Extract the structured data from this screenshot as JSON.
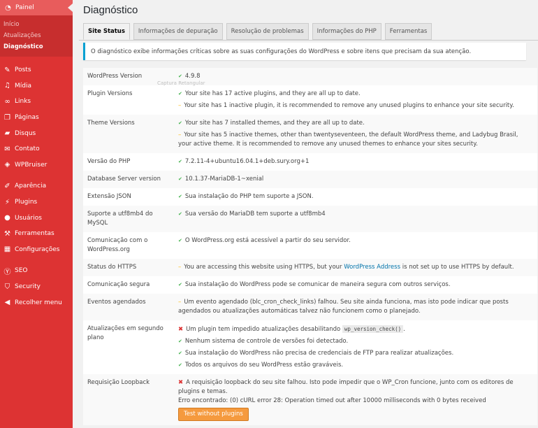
{
  "sidebar": {
    "top_item": "Painel",
    "submenu": [
      "Início",
      "Atualizações",
      "Diagnóstico"
    ],
    "items": [
      {
        "label": "Posts",
        "icon": "pushpin-icon"
      },
      {
        "label": "Mídia",
        "icon": "media-icon"
      },
      {
        "label": "Links",
        "icon": "links-icon"
      },
      {
        "label": "Páginas",
        "icon": "pages-icon"
      },
      {
        "label": "Disqus",
        "icon": "comment-icon"
      },
      {
        "label": "Contato",
        "icon": "mail-icon"
      },
      {
        "label": "WPBruiser",
        "icon": "shield-icon"
      },
      {
        "label": "Aparência",
        "icon": "brush-icon"
      },
      {
        "label": "Plugins",
        "icon": "plugin-icon"
      },
      {
        "label": "Usuários",
        "icon": "users-icon"
      },
      {
        "label": "Ferramentas",
        "icon": "wrench-icon"
      },
      {
        "label": "Configurações",
        "icon": "settings-icon"
      },
      {
        "label": "SEO",
        "icon": "yoast-icon"
      },
      {
        "label": "Security",
        "icon": "security-shield-icon"
      },
      {
        "label": "Recolher menu",
        "icon": "collapse-icon"
      }
    ]
  },
  "page_title": "Diagnóstico",
  "tabs": [
    "Site Status",
    "Informações de depuração",
    "Resolução de problemas",
    "Informações do PHP",
    "Ferramentas"
  ],
  "notice": "O diagnóstico exibe informações críticas sobre as suas configurações do WordPress e sobre itens que precisam da sua atenção.",
  "tooltip_faint": "Captura Retangular",
  "rows": {
    "wp_version": {
      "label": "WordPress Version",
      "value": "4.9.8"
    },
    "plugin_versions": {
      "label": "Plugin Versions",
      "line1": "Your site has 17 active plugins, and they are all up to date.",
      "line2": "Your site has 1 inactive plugin, it is recommended to remove any unused plugins to enhance your site security."
    },
    "theme_versions": {
      "label": "Theme Versions",
      "line1": "Your site has 7 installed themes, and they are all up to date.",
      "line2": "Your site has 5 inactive themes, other than twentyseventeen, the default WordPress theme, and Ladybug Brasil, your active theme. It is recommended to remove any unused themes to enhance your sites security."
    },
    "php_version": {
      "label": "Versão do PHP",
      "value": "7.2.11-4+ubuntu16.04.1+deb.sury.org+1"
    },
    "db_version": {
      "label": "Database Server version",
      "value": "10.1.37-MariaDB-1~xenial"
    },
    "json": {
      "label": "Extensão JSON",
      "value": "Sua instalação do PHP tem suporte a JSON."
    },
    "utf8mb4": {
      "label": "Suporte a utf8mb4 do MySQL",
      "value": "Sua versão do MariaDB tem suporte a utf8mb4"
    },
    "wporg": {
      "label": "Comunicação com o WordPress.org",
      "value": "O WordPress.org está acessível a partir do seu servidor."
    },
    "https": {
      "label": "Status do HTTPS",
      "before": "You are accessing this website using HTTPS, but your ",
      "link": "WordPress Address",
      "after": " is not set up to use HTTPS by default."
    },
    "secure_comm": {
      "label": "Comunicação segura",
      "value": "Sua instalação do WordPress pode se comunicar de maneira segura com outros serviços."
    },
    "cron": {
      "label": "Eventos agendados",
      "value": "Um evento agendado (blc_cron_check_links) falhou. Seu site ainda funciona, mas isto pode indicar que posts agendados ou atualizações automáticas talvez não funcionem como o planejado."
    },
    "bg_updates": {
      "label": "Atualizações em segundo plano",
      "line1_before": "Um plugin tem impedido atualizações desabilitando",
      "line1_code": "wp_version_check()",
      "line1_after": ".",
      "line2": "Nenhum sistema de controle de versões foi detectado.",
      "line3": "Sua instalação do WordPress não precisa de credenciais de FTP para realizar atualizações.",
      "line4": "Todos os arquivos do seu WordPress estão graváveis."
    },
    "loopback": {
      "label": "Requisição Loopback",
      "line1": "A requisição loopback do seu site falhou. Isto pode impedir que o WP_Cron funcione, junto com os editores de plugins e temas.",
      "line2": "Erro encontrado: (0) cURL error 28: Operation timed out after 10000 milliseconds with 0 bytes received",
      "button": "Test without plugins"
    }
  },
  "colors": {
    "sidebar": "#dd3333",
    "accent": "#00a0d2",
    "good": "#46b450",
    "warn": "#ffb900",
    "bad": "#dc3232",
    "button": "#f59a3e"
  }
}
